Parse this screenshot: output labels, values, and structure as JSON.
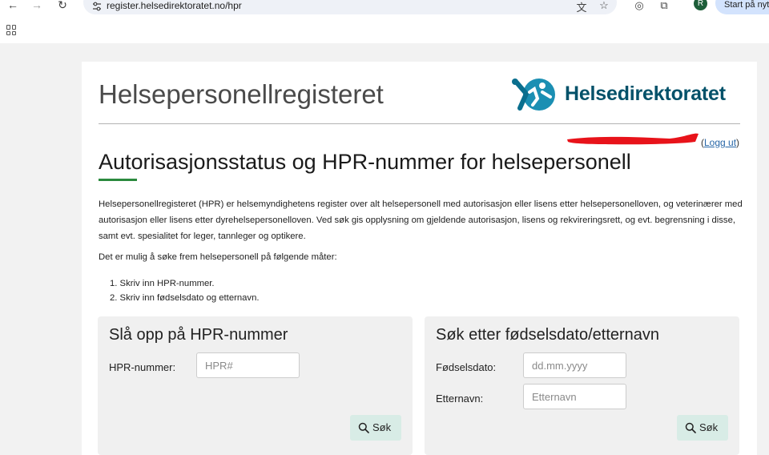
{
  "browser": {
    "url": "register.helsedirektoratet.no/hpr",
    "avatar_initial": "R",
    "start_button": "Start på nytt",
    "icons": [
      "back-arrow-icon",
      "forward-arrow-icon",
      "reload-icon",
      "site-settings-icon",
      "translate-icon",
      "bookmark-star-icon",
      "extension-icon",
      "puzzle-icon",
      "apps-grid-icon"
    ]
  },
  "header": {
    "site_title": "Helsepersonellregisteret",
    "brand_name": "Helsedirektoratet",
    "brand_color": "#025169"
  },
  "user": {
    "logout_open": "(",
    "logout_label": "Logg ut",
    "logout_close": ")"
  },
  "main": {
    "heading": "Autorisasjonsstatus og HPR-nummer for helsepersonell",
    "intro": "Helsepersonellregisteret (HPR) er helsemyndighetens register over alt helsepersonell med autorisasjon eller lisens etter helsepersonelloven, og veterinærer med autorisasjon eller lisens etter dyrehelsepersonelloven. Ved søk gis opplysning om gjeldende autorisasjon, lisens og rekvireringsrett, og evt. begrensning i disse, samt evt. spesialitet for leger, tannleger og optikere.",
    "search_ways_intro": "Det er mulig å søke frem helsepersonell på følgende måter:",
    "search_ways": [
      "1. Skriv inn HPR-nummer.",
      "2. Skriv inn fødselsdato og etternavn."
    ],
    "accent_color": "#2b8a3e"
  },
  "hpr_search": {
    "title": "Slå opp på HPR-nummer",
    "hpr_label": "HPR-nummer:",
    "hpr_placeholder": "HPR#",
    "hpr_value": "",
    "button_label": "Søk"
  },
  "name_search": {
    "title": "Søk etter fødselsdato/etternavn",
    "birthdate_label": "Fødselsdato:",
    "birthdate_placeholder": "dd.mm.yyyy",
    "birthdate_value": "",
    "surname_label": "Etternavn:",
    "surname_placeholder": "Etternavn",
    "surname_value": "",
    "button_label": "Søk"
  }
}
